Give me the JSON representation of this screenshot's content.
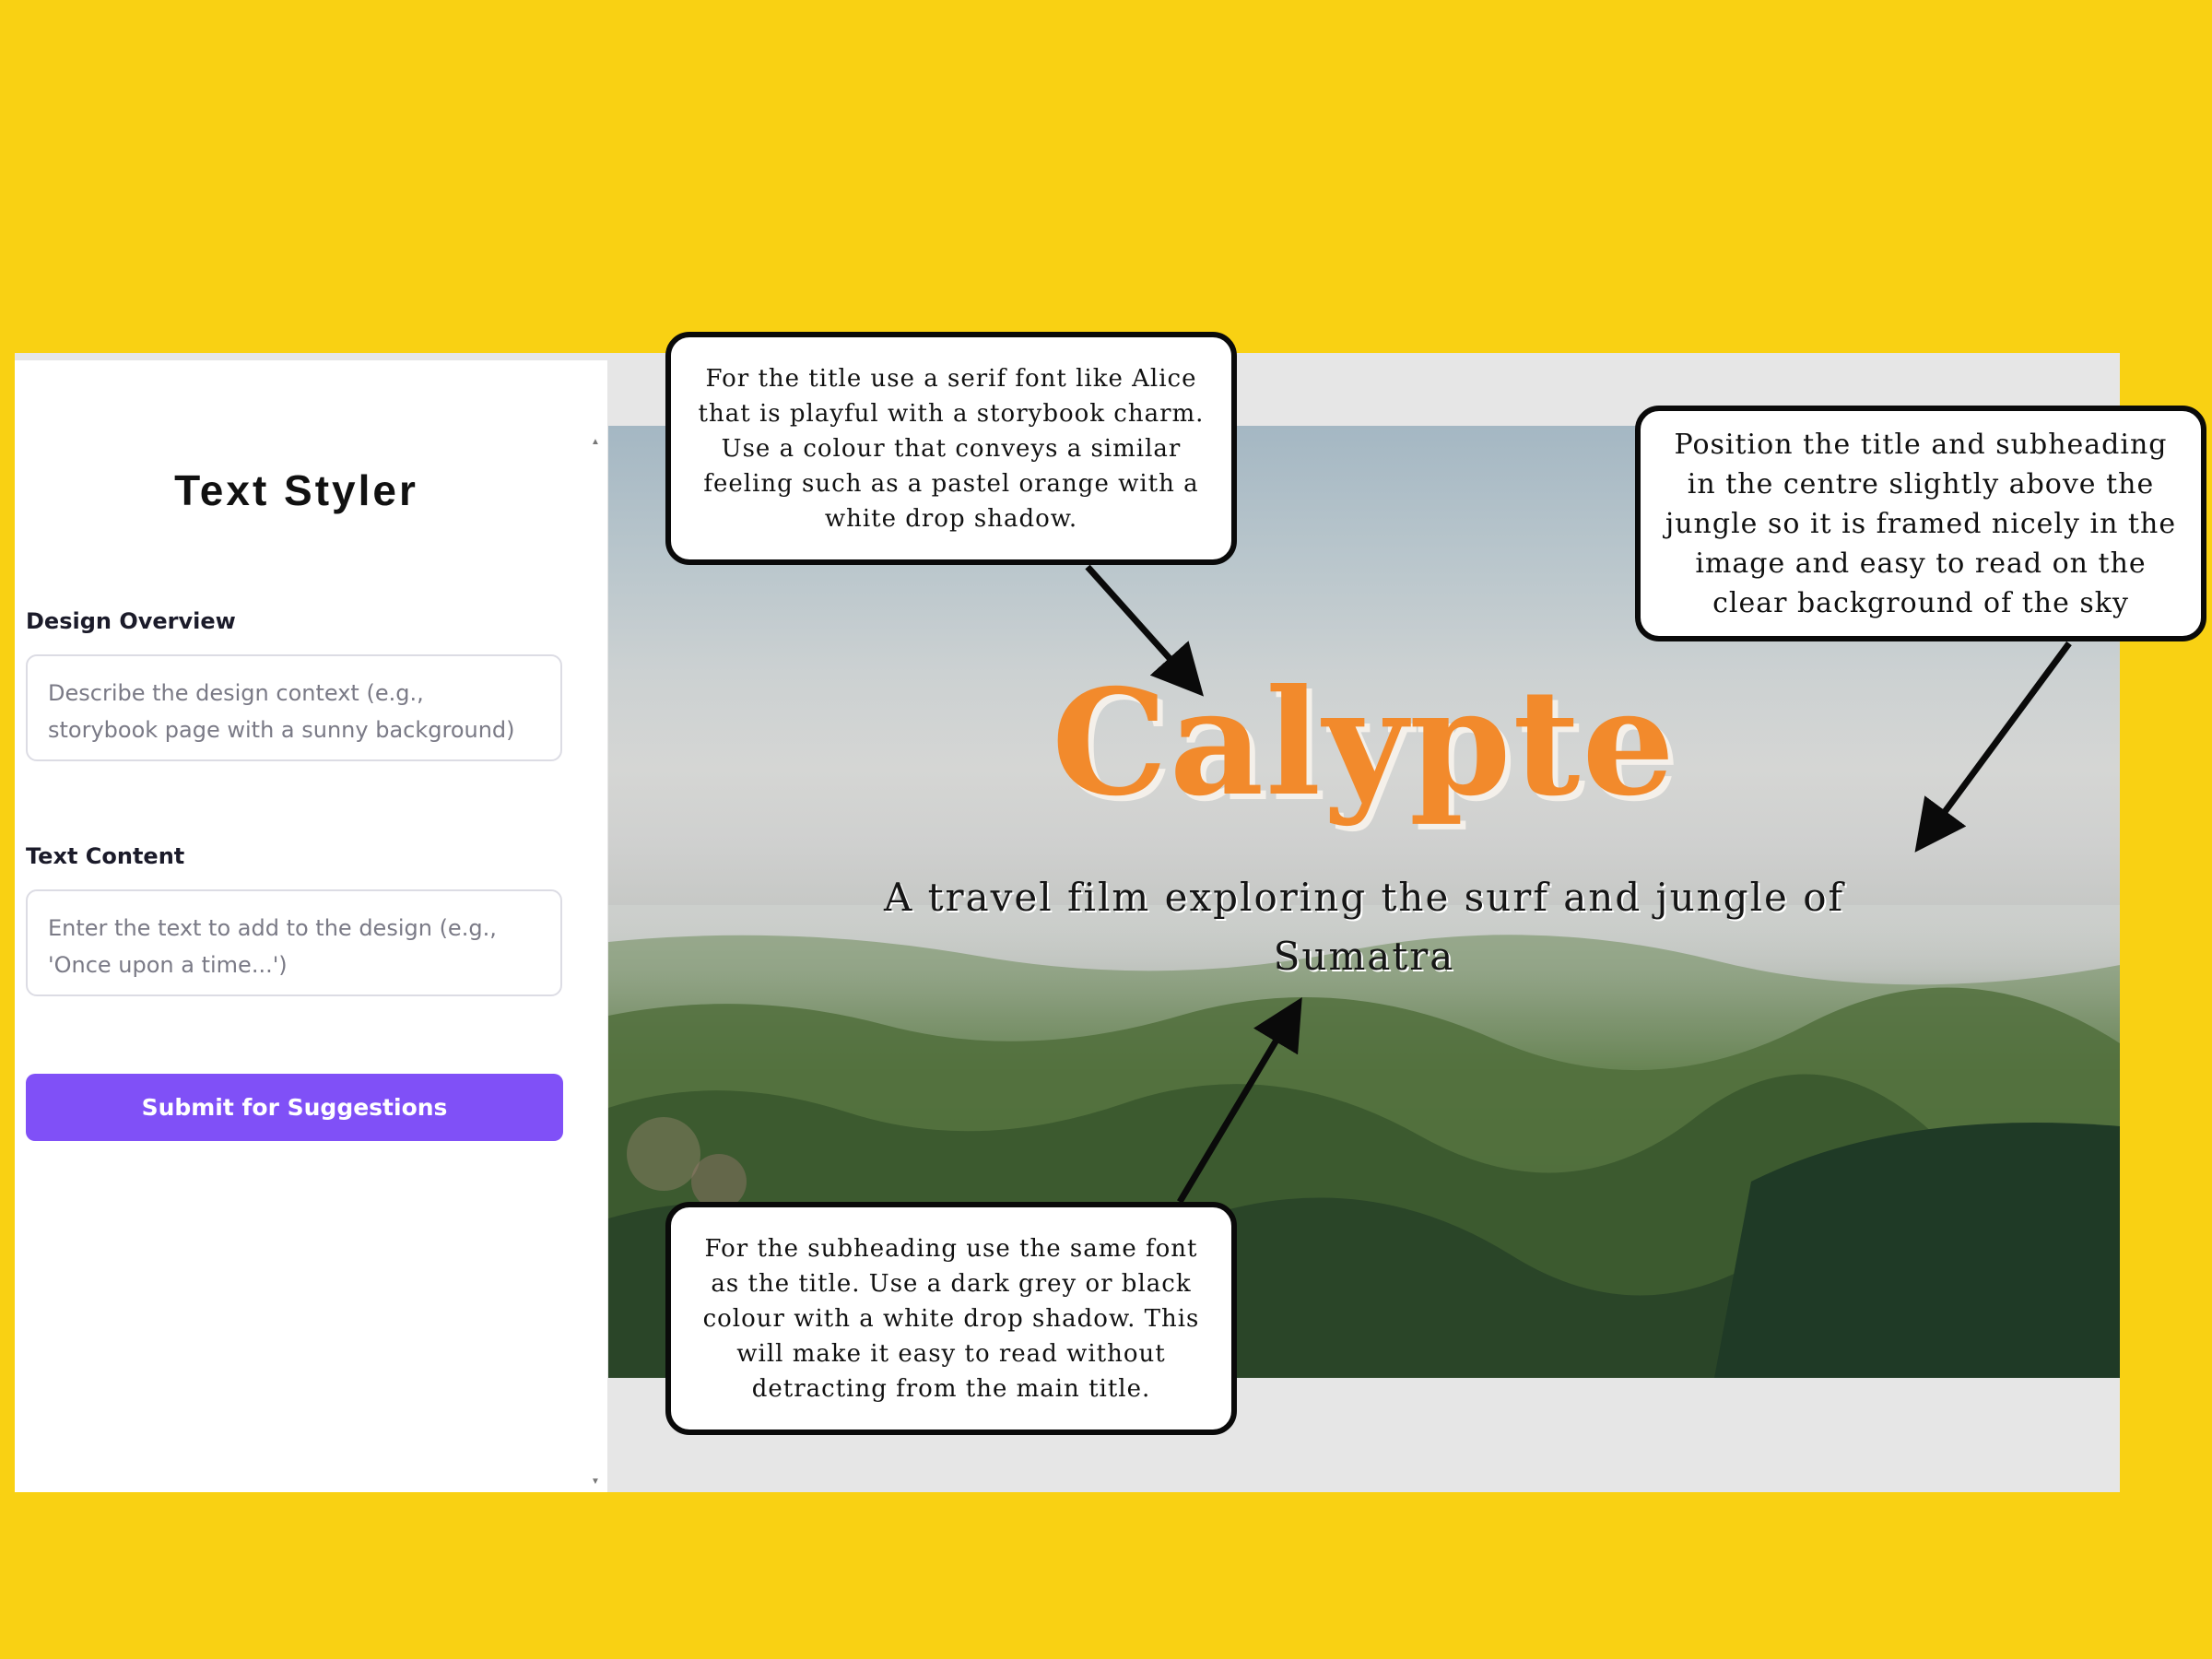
{
  "panel": {
    "title": "Text Styler",
    "design_overview": {
      "label": "Design Overview",
      "placeholder": "Describe the design context (e.g., storybook page with a sunny background)"
    },
    "text_content": {
      "label": "Text Content",
      "placeholder": "Enter the text to add to the design (e.g., 'Once upon a time...')"
    },
    "submit_label": "Submit for Suggestions"
  },
  "canvas": {
    "title": "Calypte",
    "subheading": "A travel film exploring the surf and jungle of Sumatra"
  },
  "notes": {
    "title_note": "For the title use a serif font like Alice that is playful with a storybook charm. Use a colour that conveys a similar feeling such as a pastel orange with a white drop shadow.",
    "position_note": "Position the title and subheading in the centre slightly above the jungle so it is framed nicely in the image and easy to read on the clear background of the sky",
    "subheading_note": "For the subheading use the same font as the title. Use a dark grey or black colour with a white drop shadow. This will make it easy to read without detracting from the main title."
  },
  "colors": {
    "background": "#f9d113",
    "accent_button": "#8050f7",
    "title_orange": "#f28a2c"
  }
}
